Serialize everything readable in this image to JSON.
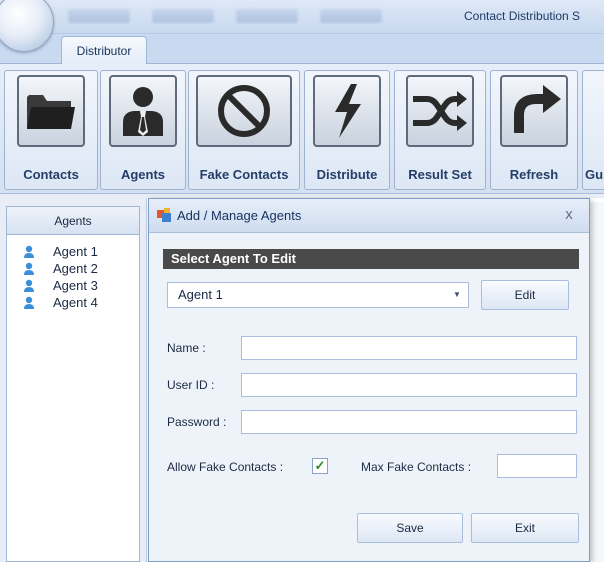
{
  "window": {
    "title": "Contact Distribution S"
  },
  "ribbon_tab": {
    "active_label": "Distributor"
  },
  "ribbon": {
    "buttons": [
      {
        "label": "Contacts",
        "icon": "folder-icon"
      },
      {
        "label": "Agents",
        "icon": "agent-icon"
      },
      {
        "label": "Fake Contacts",
        "icon": "no-entry-icon"
      },
      {
        "label": "Distribute",
        "icon": "lightning-icon"
      },
      {
        "label": "Result Set",
        "icon": "shuffle-icon"
      },
      {
        "label": "Refresh",
        "icon": "refresh-arrow-icon"
      },
      {
        "label": "Gu",
        "icon": ""
      }
    ]
  },
  "left_panel": {
    "header": "Agents",
    "agents": [
      "Agent 1",
      "Agent 2",
      "Agent 3",
      "Agent 4"
    ]
  },
  "dialog": {
    "title": "Add / Manage Agents",
    "close_label": "x",
    "section_title": "Select Agent To Edit",
    "selected_agent": "Agent 1",
    "edit_label": "Edit",
    "name_label": "Name :",
    "name_value": "",
    "userid_label": "User ID :",
    "userid_value": "",
    "password_label": "Password :",
    "password_value": "",
    "allow_fake_label": "Allow Fake Contacts :",
    "allow_fake_checked": true,
    "max_fake_label": "Max Fake Contacts :",
    "max_fake_value": "",
    "save_label": "Save",
    "exit_label": "Exit"
  },
  "colors": {
    "ribbon_bg": "#d4e1f2",
    "section_head_bg": "#4a4a4a",
    "agent_icon": "#3a8fd8",
    "check_green": "#2f8a2f"
  }
}
